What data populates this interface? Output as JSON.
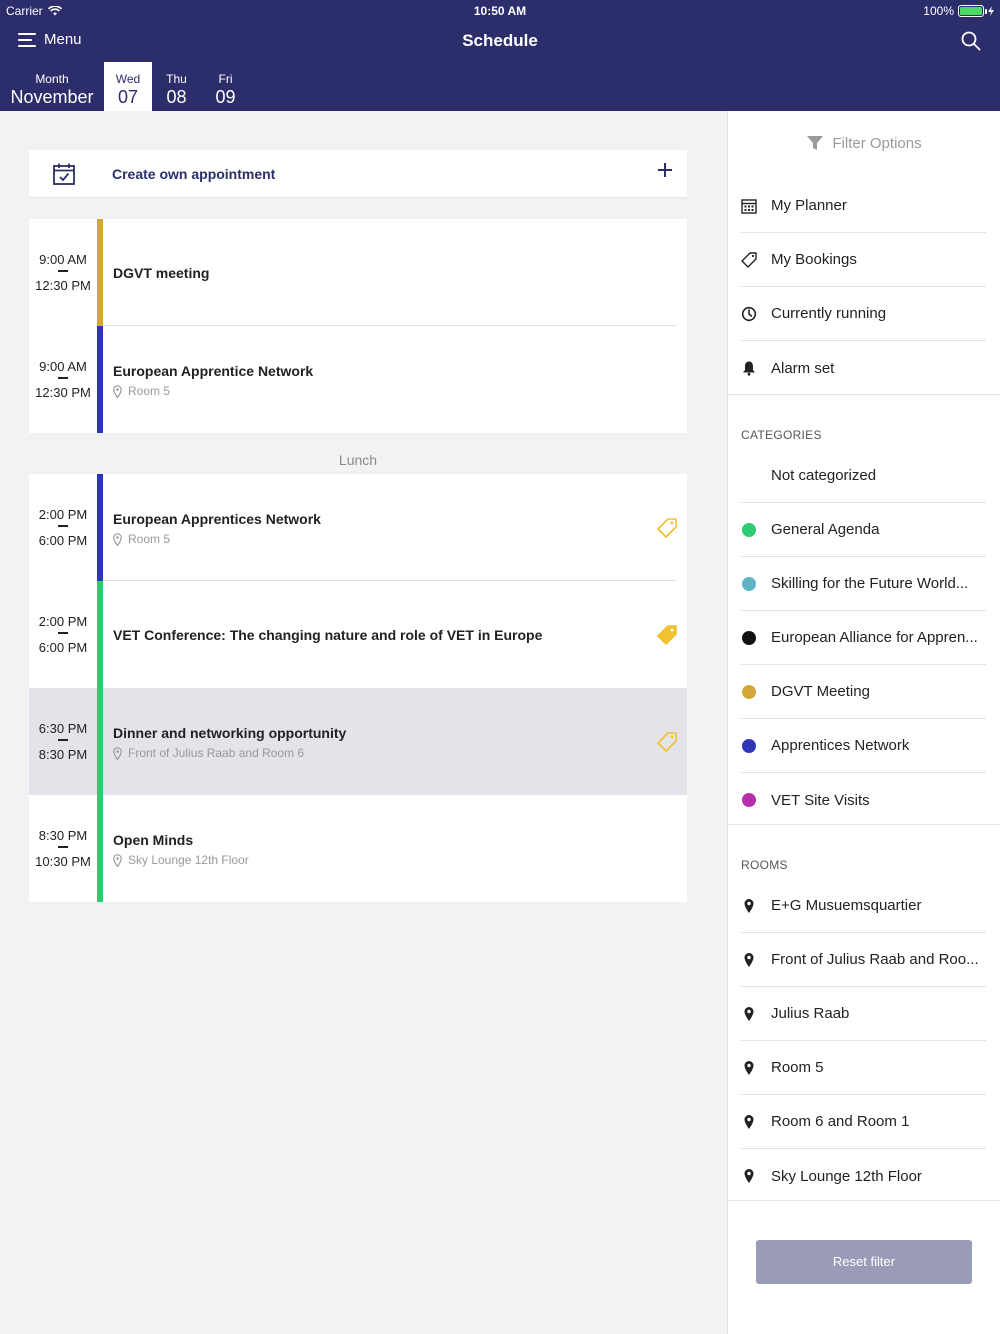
{
  "status": {
    "carrier": "Carrier",
    "time": "10:50 AM",
    "battery": "100%"
  },
  "nav": {
    "menu_label": "Menu",
    "title": "Schedule"
  },
  "days": {
    "month_label": "Month",
    "month_value": "November",
    "items": [
      {
        "label": "Wed",
        "num": "07"
      },
      {
        "label": "Thu",
        "num": "08"
      },
      {
        "label": "Fri",
        "num": "09"
      }
    ]
  },
  "create": {
    "label": "Create own appointment"
  },
  "lunch_label": "Lunch",
  "sessions": [
    {
      "start": "9:00 AM",
      "end": "12:30 PM",
      "title": "DGVT meeting",
      "location": "",
      "color": "#d4a73a"
    },
    {
      "start": "9:00 AM",
      "end": "12:30 PM",
      "title": "European Apprentice Network",
      "location": "Room 5",
      "color": "#2f37b8"
    },
    {
      "start": "2:00 PM",
      "end": "6:00 PM",
      "title": "European Apprentices Network",
      "location": "Room 5",
      "color": "#2f37b8"
    },
    {
      "start": "2:00 PM",
      "end": "6:00 PM",
      "title": "VET Conference: The changing nature and role of VET in Europe",
      "location": "",
      "color": "#2ecc71"
    },
    {
      "start": "6:30 PM",
      "end": "8:30 PM",
      "title": "Dinner and networking opportunity",
      "location": "Front of Julius Raab and Room 6",
      "color": "#2ecc71"
    },
    {
      "start": "8:30 PM",
      "end": "10:30 PM",
      "title": "Open Minds",
      "location": "Sky Lounge 12th Floor",
      "color": "#2ecc71"
    }
  ],
  "sidebar": {
    "filter_label": "Filter Options",
    "quick": [
      {
        "label": "My Planner",
        "icon": "calendar-grid-icon"
      },
      {
        "label": "My Bookings",
        "icon": "ticket-icon"
      },
      {
        "label": "Currently running",
        "icon": "clock-icon"
      },
      {
        "label": "Alarm set",
        "icon": "bell-icon"
      }
    ],
    "categories_label": "CATEGORIES",
    "categories": [
      {
        "label": "Not categorized",
        "color": ""
      },
      {
        "label": "General Agenda",
        "color": "#2ecc71"
      },
      {
        "label": "Skilling for the Future World...",
        "color": "#5fb4c4"
      },
      {
        "label": "European Alliance for Appren...",
        "color": "#111111"
      },
      {
        "label": "DGVT Meeting",
        "color": "#d4a73a"
      },
      {
        "label": "Apprentices Network",
        "color": "#2f37b8"
      },
      {
        "label": "VET Site Visits",
        "color": "#b62fa9"
      }
    ],
    "rooms_label": "ROOMS",
    "rooms": [
      {
        "label": "E+G Musuemsquartier"
      },
      {
        "label": "Front of Julius Raab and Roo..."
      },
      {
        "label": "Julius Raab"
      },
      {
        "label": "Room 5"
      },
      {
        "label": "Room 6 and Room 1"
      },
      {
        "label": "Sky Lounge 12th Floor"
      }
    ],
    "reset_label": "Reset filter"
  },
  "colors": {
    "header": "#2b2e6a",
    "tag_gold": "#f2c12e"
  }
}
